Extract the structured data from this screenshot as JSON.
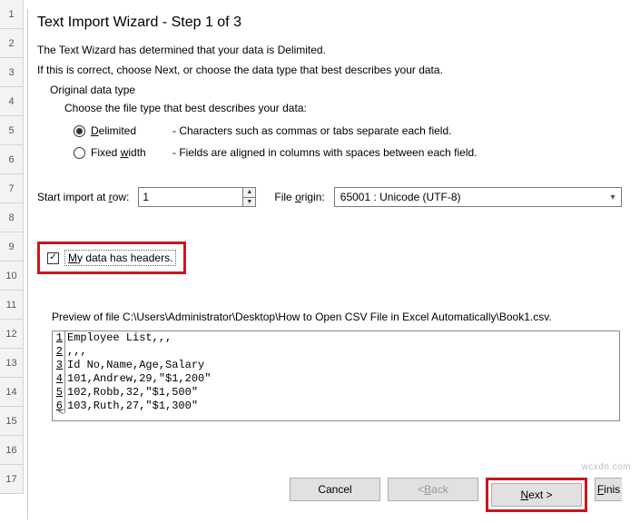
{
  "rows": [
    "1",
    "2",
    "3",
    "4",
    "5",
    "6",
    "7",
    "8",
    "9",
    "10",
    "11",
    "12",
    "13",
    "14",
    "15",
    "16",
    "17"
  ],
  "dialog": {
    "title": "Text Import Wizard - Step 1 of 3",
    "intro1": "The Text Wizard has determined that your data is Delimited.",
    "intro2": "If this is correct, choose Next, or choose the data type that best describes your data.",
    "original_label": "Original data type",
    "choose_label": "Choose the file type that best describes your data:",
    "radios": {
      "delimited": {
        "label": "Delimited",
        "desc": "- Characters such as commas or tabs separate each field."
      },
      "fixed": {
        "label": "Fixed width",
        "desc": "- Fields are aligned in columns with spaces between each field."
      }
    },
    "start_label": "Start import at row:",
    "start_value": "1",
    "origin_label": "File origin:",
    "origin_value": "65001 : Unicode (UTF-8)",
    "headers_label": "My data has headers.",
    "preview_label": "Preview of file C:\\Users\\Administrator\\Desktop\\How to Open CSV File in Excel Automatically\\Book1.csv.",
    "preview_lines": [
      "Employee List,,,",
      ",,,",
      "Id No,Name,Age,Salary",
      "101,Andrew,29,\"$1,200\"",
      "102,Robb,32,\"$1,500\"",
      "103,Ruth,27,\"$1,300\""
    ],
    "buttons": {
      "cancel": "Cancel",
      "back": "< Back",
      "next": "Next >",
      "finish": "Finis"
    }
  },
  "watermark": "wcxdn.com"
}
